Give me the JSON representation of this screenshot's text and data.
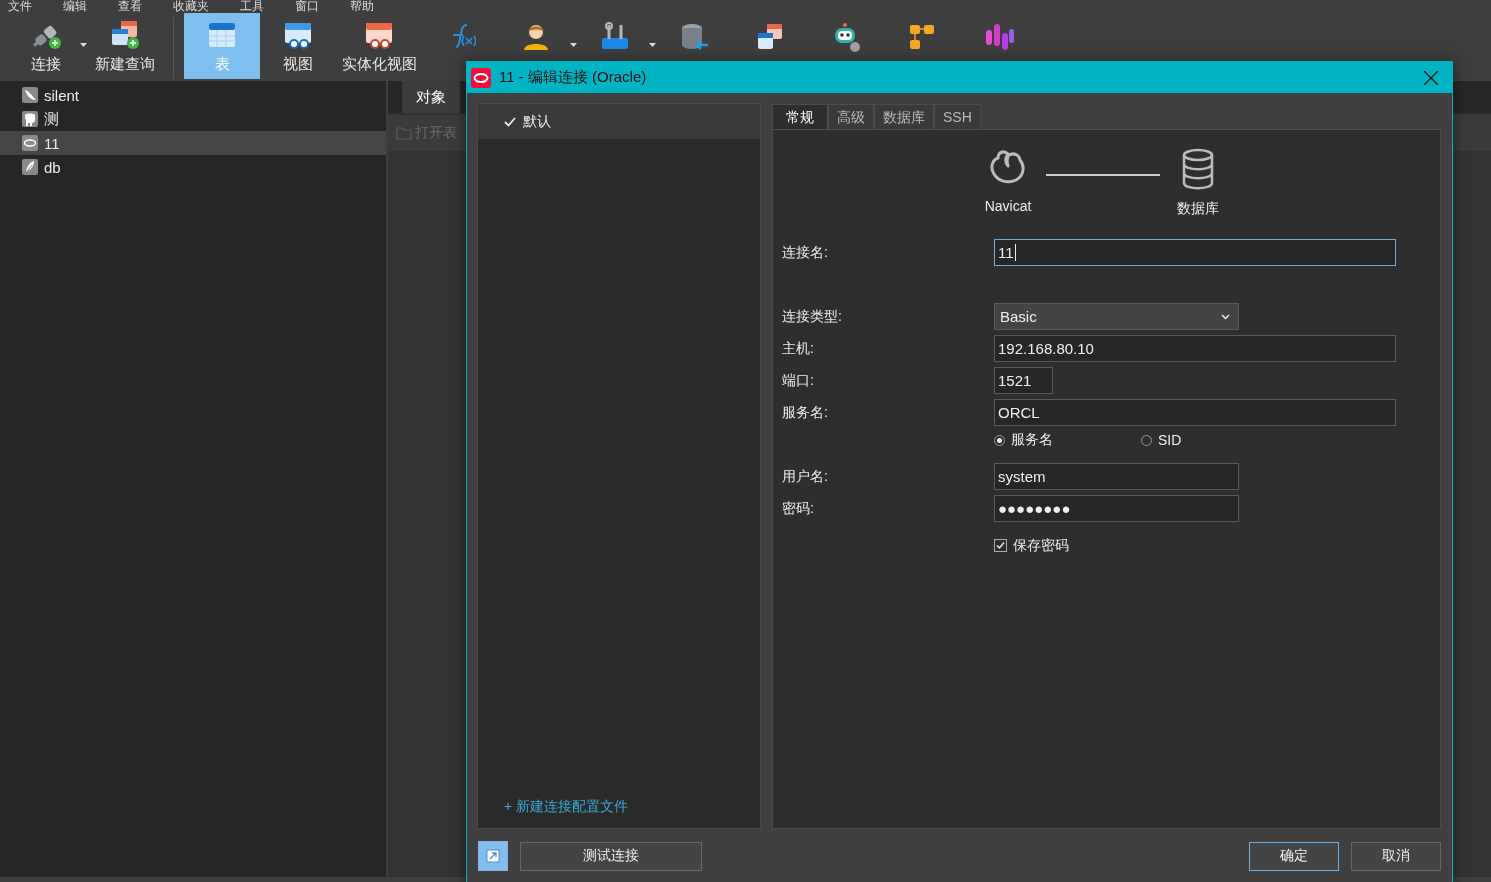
{
  "menu": [
    "文件",
    "编辑",
    "查看",
    "收藏夹",
    "工具",
    "窗口",
    "帮助"
  ],
  "toolbar": [
    {
      "label": "连接",
      "selected": false,
      "dropdown": true
    },
    {
      "label": "新建查询",
      "selected": false,
      "dropdown": false
    },
    {
      "label": "表",
      "selected": true,
      "dropdown": false
    },
    {
      "label": "视图",
      "selected": false,
      "dropdown": false
    },
    {
      "label": "实体化视图",
      "selected": false,
      "dropdown": false
    },
    {
      "selected": false,
      "dropdown": false
    },
    {
      "selected": false,
      "dropdown": true
    },
    {
      "selected": false,
      "dropdown": true
    },
    {
      "selected": false,
      "dropdown": false
    },
    {
      "selected": false,
      "dropdown": false
    },
    {
      "selected": false,
      "dropdown": false
    },
    {
      "selected": false,
      "dropdown": false
    },
    {
      "selected": false,
      "dropdown": false
    }
  ],
  "sidebar": {
    "items": [
      {
        "label": "silent",
        "selected": false
      },
      {
        "label": "测",
        "selected": false
      },
      {
        "label": "11",
        "selected": true
      },
      {
        "label": "db",
        "selected": false
      }
    ]
  },
  "workspace": {
    "tabs": [
      {
        "label": "对象",
        "selected": true
      }
    ],
    "tools": [
      {
        "label": "打开表",
        "disabled": true
      }
    ]
  },
  "dialog": {
    "title": "11 - 编辑连接 (Oracle)",
    "profiles": [
      {
        "label": "默认",
        "selected": true
      }
    ],
    "new_profile_link": "+ 新建连接配置文件",
    "tabs": [
      {
        "label": "常规",
        "selected": true
      },
      {
        "label": "高级",
        "selected": false
      },
      {
        "label": "数据库",
        "selected": false
      },
      {
        "label": "SSH",
        "selected": false
      }
    ],
    "diagram": {
      "client": "Navicat",
      "server": "数据库"
    },
    "fields": [
      {
        "kind": "text",
        "label": "连接名:",
        "value": "11",
        "focused": true
      },
      {
        "kind": "select",
        "label": "连接类型:",
        "value": "Basic"
      },
      {
        "kind": "text",
        "label": "主机:",
        "value": "192.168.80.10",
        "focused": false
      },
      {
        "kind": "text",
        "label": "端口:",
        "value": "1521",
        "focused": false
      },
      {
        "kind": "text",
        "label": "服务名:",
        "value": "ORCL",
        "focused": false
      },
      {
        "kind": "radio",
        "options": [
          {
            "label": "服务名",
            "selected": true
          },
          {
            "label": "SID",
            "selected": false
          }
        ]
      },
      {
        "kind": "text",
        "label": "用户名:",
        "value": "system",
        "focused": false
      },
      {
        "kind": "text",
        "label": "密码:",
        "value": "●●●●●●●●",
        "focused": false
      },
      {
        "kind": "checkbox",
        "label": "保存密码",
        "checked": true
      }
    ],
    "buttons": [
      {
        "label": "测试连接",
        "focused": false
      },
      {
        "label": "确定",
        "focused": true
      },
      {
        "label": "取消",
        "focused": false
      }
    ]
  }
}
